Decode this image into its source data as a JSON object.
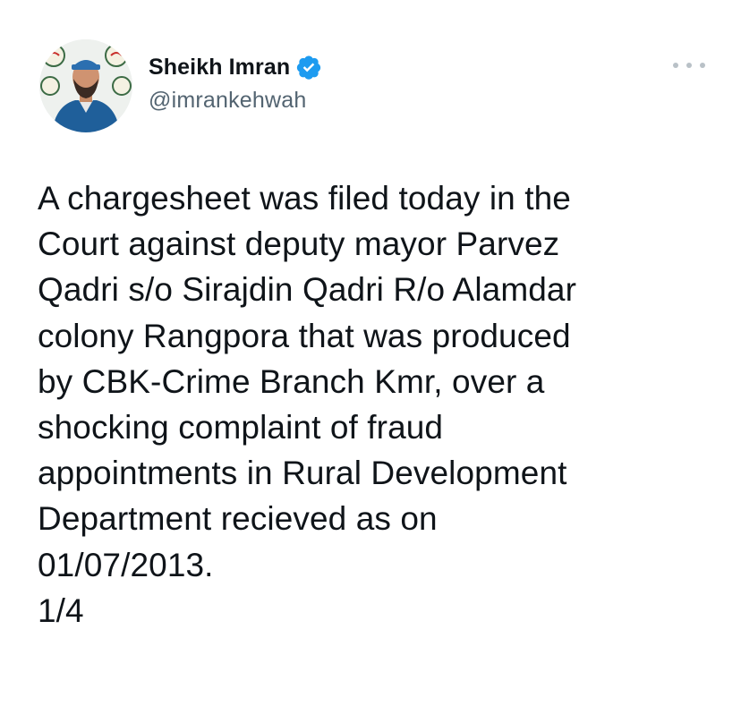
{
  "author": {
    "display_name": "Sheikh Imran",
    "handle": "@imrankehwah",
    "verified": true,
    "verified_color": "#1d9bf0",
    "avatar": "avatar-photo"
  },
  "actions": {
    "more_icon": "more-horizontal-icon"
  },
  "tweet": {
    "lines": [
      "A chargesheet was filed today in the",
      "Court against deputy mayor Parvez",
      "Qadri s/o Sirajdin Qadri R/o Alamdar",
      "colony Rangpora that was produced",
      "by CBK-Crime Branch Kmr, over a",
      "shocking complaint of fraud",
      "appointments in Rural Development",
      "Department recieved as on",
      "01/07/2013.",
      "1/4"
    ]
  }
}
